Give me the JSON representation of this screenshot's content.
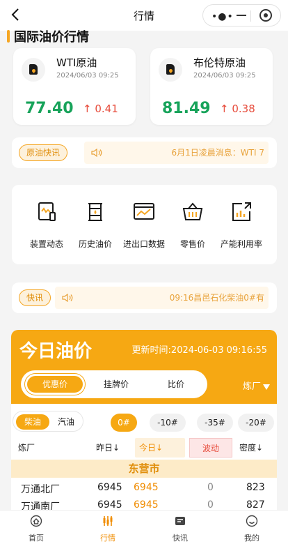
{
  "navbar": {
    "title": "行情",
    "menu_dots": "•●•"
  },
  "section_title": "国际油价行情",
  "cards": [
    {
      "name": "WTI原油",
      "time": "2024/06/03 09:25",
      "price": "77.40",
      "change": "0.41",
      "direction": "up"
    },
    {
      "name": "布伦特原油",
      "time": "2024/06/03 09:25",
      "price": "81.49",
      "change": "0.38",
      "direction": "up"
    }
  ],
  "news1": {
    "tag": "原油快讯",
    "text": "6月1日凌晨消息：WTI 7"
  },
  "grid": [
    {
      "label": "装置动态",
      "icon": "device-icon"
    },
    {
      "label": "历史油价",
      "icon": "oil-barrel-icon"
    },
    {
      "label": "进出口数据",
      "icon": "monitor-chart-icon"
    },
    {
      "label": "零售价",
      "icon": "basket-icon"
    },
    {
      "label": "产能利用率",
      "icon": "export-chart-icon"
    }
  ],
  "news2": {
    "tag": "快讯",
    "text": "09:16昌邑石化柴油0#有"
  },
  "today": {
    "title": "今日油价",
    "update": "更新时间:2024-06-03 09:16:55",
    "tabs": [
      "优惠价",
      "挂牌价",
      "比价"
    ],
    "active_tab": "优惠价",
    "refinery": "炼厂",
    "fuel_types": [
      "柴油",
      "汽油"
    ],
    "active_fuel": "柴油",
    "grades": [
      "0#",
      "-10#",
      "-35#",
      "-20#"
    ],
    "active_grade": "0#",
    "headers": {
      "refinery": "炼厂",
      "yesterday": "昨日↓",
      "today": "今日↓",
      "wave": "波动",
      "density": "密度↓"
    },
    "city": "东营市",
    "rows": [
      {
        "name": "万通北厂",
        "yesterday": "6945",
        "today": "6945",
        "wave": "0",
        "density": "823"
      },
      {
        "name": "万通南厂",
        "yesterday": "6945",
        "today": "6945",
        "wave": "0",
        "density": "827"
      }
    ]
  },
  "tabbar": [
    {
      "label": "首页",
      "icon": "home-icon"
    },
    {
      "label": "行情",
      "icon": "market-icon"
    },
    {
      "label": "快讯",
      "icon": "news-icon"
    },
    {
      "label": "我的",
      "icon": "profile-icon"
    }
  ],
  "active_tabbar": "行情",
  "colors": {
    "accent": "#f6a813",
    "up": "#e74c3c",
    "price": "#17a35a"
  }
}
